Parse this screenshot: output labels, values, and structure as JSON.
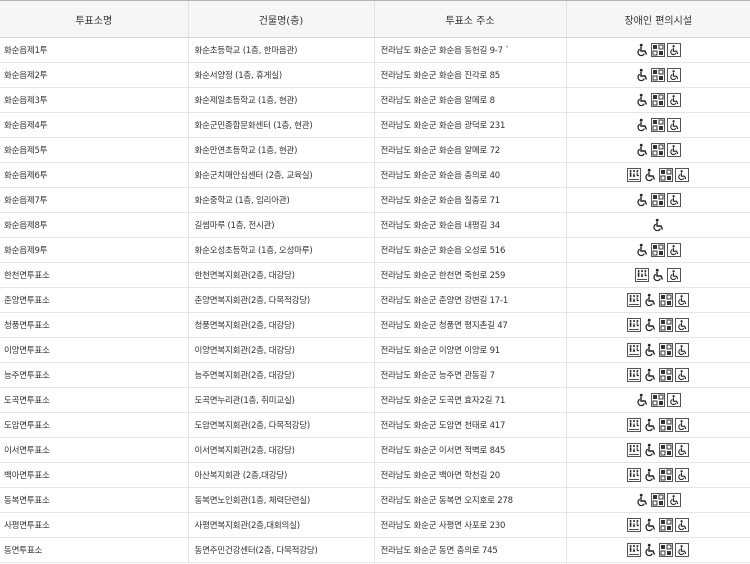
{
  "table": {
    "headers": [
      "투표소명",
      "건물명(층)",
      "투표소 주소",
      "장애인 편의시설"
    ],
    "rows": [
      {
        "name": "화순읍제1투",
        "building": "화순초등학교 (1층, 한마음관)",
        "address": "전라남도 화순군 화순읍 동헌길 9-7 `",
        "icons": [
          "wheelchair-icon",
          "braille-block-icon",
          "accessible-parking-icon"
        ]
      },
      {
        "name": "화순읍제2투",
        "building": "화순서양정 (1층, 휴게실)",
        "address": "전라남도 화순군 화순읍 진각로 85",
        "icons": [
          "wheelchair-icon",
          "braille-block-icon",
          "accessible-parking-icon"
        ]
      },
      {
        "name": "화순읍제3투",
        "building": "화순제일초등학교 (1층, 현관)",
        "address": "전라남도 화순군 화순읍 알메로 8",
        "icons": [
          "wheelchair-icon",
          "braille-block-icon",
          "accessible-parking-icon"
        ]
      },
      {
        "name": "화순읍제4투",
        "building": "화순군민종합문화센터 (1층, 현관)",
        "address": "전라남도 화순군 화순읍 광덕로 231",
        "icons": [
          "wheelchair-icon",
          "braille-block-icon",
          "accessible-parking-icon"
        ]
      },
      {
        "name": "화순읍제5투",
        "building": "화순만연초등학교 (1층, 현관)",
        "address": "전라남도 화순군 화순읍 알메로 72",
        "icons": [
          "wheelchair-icon",
          "braille-block-icon",
          "accessible-parking-icon"
        ]
      },
      {
        "name": "화순읍제6투",
        "building": "화순군치매안심센터 (2층, 교육실)",
        "address": "전라남도 화순군 화순읍 충의로 40",
        "icons": [
          "accessible-restroom-icon",
          "wheelchair-icon",
          "braille-block-icon",
          "accessible-parking-icon"
        ]
      },
      {
        "name": "화순읍제7투",
        "building": "화순중학교 (1층, 임리아관)",
        "address": "전라남도 화순군 화순읍 칠충로 71",
        "icons": [
          "wheelchair-icon",
          "braille-block-icon",
          "accessible-parking-icon"
        ]
      },
      {
        "name": "화순읍제8투",
        "building": "길썸마루 (1층, 전시관)",
        "address": "전라남도 화순군 화순읍 내평길 34",
        "icons": [
          "wheelchair-icon"
        ]
      },
      {
        "name": "화순읍제9투",
        "building": "화순오성초등학교 (1층, 오성마루)",
        "address": "전라남도 화순군 화순읍 오성로 516",
        "icons": [
          "wheelchair-icon",
          "braille-block-icon",
          "accessible-parking-icon"
        ]
      },
      {
        "name": "한천면투표소",
        "building": "한천면복지회관(2층, 대강당)",
        "address": "전라남도 화순군 한천면 죽헌로 259",
        "icons": [
          "accessible-restroom-icon",
          "wheelchair-icon",
          "accessible-parking-icon"
        ]
      },
      {
        "name": "춘양면투표소",
        "building": "춘양면복지회관(2층, 다목적강당)",
        "address": "전라남도 화순군 춘양면 강변길 17-1",
        "icons": [
          "accessible-restroom-icon",
          "wheelchair-icon",
          "braille-block-icon",
          "accessible-parking-icon"
        ]
      },
      {
        "name": "청풍면투표소",
        "building": "청풍면복지회관(2층, 대강당)",
        "address": "전라남도 화순군 청풍면 평지촌길 47",
        "icons": [
          "accessible-restroom-icon",
          "wheelchair-icon",
          "braille-block-icon",
          "accessible-parking-icon"
        ]
      },
      {
        "name": "이양면투표소",
        "building": "이양면복지회관(2층, 대강당)",
        "address": "전라남도 화순군 이양면 이양로 91",
        "icons": [
          "accessible-restroom-icon",
          "wheelchair-icon",
          "braille-block-icon",
          "accessible-parking-icon"
        ]
      },
      {
        "name": "능주면투표소",
        "building": "능주면복지회관(2층, 대강당)",
        "address": "전라남도 화순군 능주면 관동길 7",
        "icons": [
          "accessible-restroom-icon",
          "wheelchair-icon",
          "braille-block-icon",
          "accessible-parking-icon"
        ]
      },
      {
        "name": "도곡면투표소",
        "building": "도곡면누리관(1층, 취미교실)",
        "address": "전라남도 화순군 도곡면 효자2길 71",
        "icons": [
          "wheelchair-icon",
          "braille-block-icon",
          "accessible-parking-icon"
        ]
      },
      {
        "name": "도암면투표소",
        "building": "도암면복지회관(2층, 다목적강당)",
        "address": "전라남도 화순군 도암면 천태로 417",
        "icons": [
          "accessible-restroom-icon",
          "wheelchair-icon",
          "braille-block-icon",
          "accessible-parking-icon"
        ]
      },
      {
        "name": "이서면투표소",
        "building": "이서면복지회관(2층, 대강당)",
        "address": "전라남도 화순군 이서면 적벽로 845",
        "icons": [
          "accessible-restroom-icon",
          "wheelchair-icon",
          "braille-block-icon",
          "accessible-parking-icon"
        ]
      },
      {
        "name": "백아면투표소",
        "building": "아산복지회관 (2층,대강당)",
        "address": "전라남도 화순군 백아면 학천길 20",
        "icons": [
          "accessible-restroom-icon",
          "wheelchair-icon",
          "braille-block-icon",
          "accessible-parking-icon"
        ]
      },
      {
        "name": "동복면투표소",
        "building": "동복면노인회관(1층, 체력단련실)",
        "address": "전라남도 화순군 동복면 오지호로 278",
        "icons": [
          "wheelchair-icon",
          "braille-block-icon",
          "accessible-parking-icon"
        ]
      },
      {
        "name": "사평면투표소",
        "building": "사평면복지회관(2층,대회의실)",
        "address": "전라남도 화순군 사평면 사포로 230",
        "icons": [
          "accessible-restroom-icon",
          "wheelchair-icon",
          "braille-block-icon",
          "accessible-parking-icon"
        ]
      },
      {
        "name": "동면투표소",
        "building": "동면주민건강센터(2층, 다목적강당)",
        "address": "전라남도 화순군 동면 충의로 745",
        "icons": [
          "accessible-restroom-icon",
          "wheelchair-icon",
          "braille-block-icon",
          "accessible-parking-icon"
        ]
      }
    ]
  }
}
